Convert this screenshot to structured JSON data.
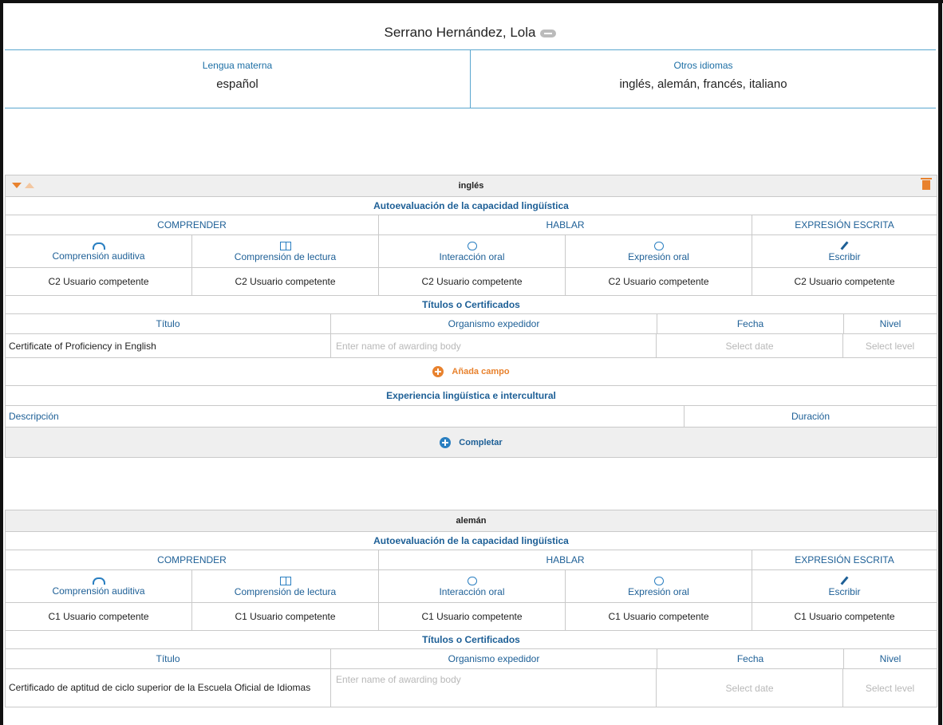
{
  "header": {
    "name": "Serrano Hernández, Lola"
  },
  "summary": {
    "mother_tongue_label": "Lengua materna",
    "mother_tongue": "español",
    "other_label": "Otros idiomas",
    "other_languages": "inglés, alemán, francés, italiano"
  },
  "languages": [
    {
      "title": "inglés",
      "self_assessment": "Autoevaluación de la capacidad lingüística",
      "categories": [
        "COMPRENDER",
        "HABLAR",
        "EXPRESIÓN ESCRITA"
      ],
      "skills": [
        "Comprensión auditiva",
        "Comprensión de lectura",
        "Interacción oral",
        "Expresión oral",
        "Escribir"
      ],
      "levels": [
        "C2 Usuario competente",
        "C2 Usuario competente",
        "C2 Usuario competente",
        "C2 Usuario competente",
        "C2 Usuario competente"
      ],
      "certs_heading": "Títulos o Certificados",
      "cert_columns": [
        "Título",
        "Organismo expedidor",
        "Fecha",
        "Nivel"
      ],
      "cert": {
        "title": "Certificate of Proficiency in English",
        "body_placeholder": "Enter name of awarding body",
        "date_placeholder": "Select date",
        "level_placeholder": "Select level"
      },
      "add_field": "Añada campo",
      "experience_heading": "Experiencia lingüística e intercultural",
      "description_label": "Descripción",
      "duration_label": "Duración",
      "complete": "Completar"
    },
    {
      "title": "alemán",
      "self_assessment": "Autoevaluación de la capacidad lingüística",
      "categories": [
        "COMPRENDER",
        "HABLAR",
        "EXPRESIÓN ESCRITA"
      ],
      "skills": [
        "Comprensión auditiva",
        "Comprensión de lectura",
        "Interacción oral",
        "Expresión oral",
        "Escribir"
      ],
      "levels": [
        "C1 Usuario competente",
        "C1 Usuario competente",
        "C1 Usuario competente",
        "C1 Usuario competente",
        "C1 Usuario competente"
      ],
      "certs_heading": "Títulos o Certificados",
      "cert_columns": [
        "Título",
        "Organismo expedidor",
        "Fecha",
        "Nivel"
      ],
      "cert": {
        "title": "Certificado de aptitud de ciclo superior de la Escuela Oficial de Idiomas",
        "body_placeholder": "Enter name of awarding body",
        "date_placeholder": "Select date",
        "level_placeholder": "Select level"
      }
    }
  ]
}
